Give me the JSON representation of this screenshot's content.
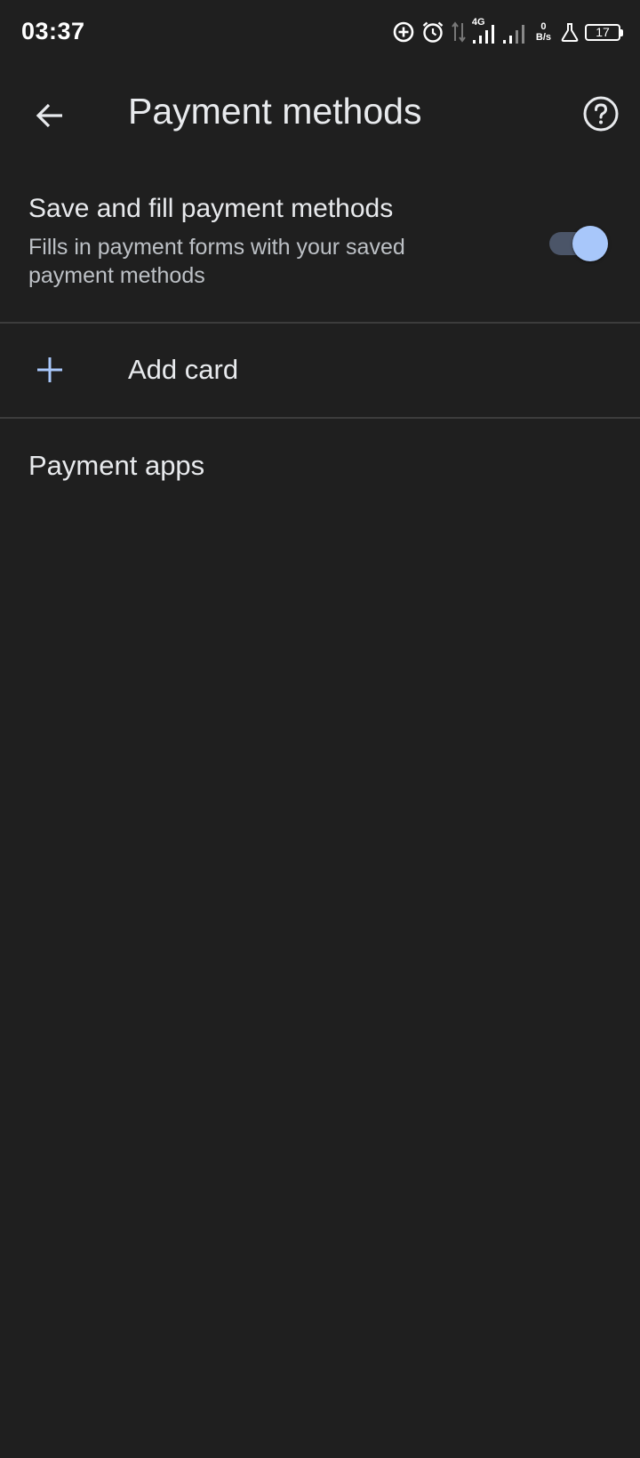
{
  "status_bar": {
    "time": "03:37",
    "network_type": "4G",
    "net_speed_value": "0",
    "net_speed_unit": "B/s",
    "battery_level": "17",
    "icons": [
      "data-saver-icon",
      "alarm-icon",
      "data-arrows-icon",
      "signal-icon-sim1",
      "signal-icon-sim2",
      "flask-icon",
      "battery-icon"
    ]
  },
  "app_bar": {
    "title": "Payment methods",
    "back_icon": "arrow-left-icon",
    "help_icon": "help-circle-icon"
  },
  "settings": {
    "save_fill": {
      "title": "Save and fill payment methods",
      "summary": "Fills in payment forms with your saved payment methods",
      "enabled": true
    },
    "add_card": {
      "label": "Add card",
      "icon": "plus-icon"
    },
    "payment_apps": {
      "label": "Payment apps"
    }
  },
  "colors": {
    "background": "#1f1f1f",
    "text_primary": "#e8eaed",
    "text_secondary": "#bdc1c6",
    "accent": "#a8c7fa",
    "toggle_track": "#4b5568",
    "divider": "#3c3c3c"
  }
}
